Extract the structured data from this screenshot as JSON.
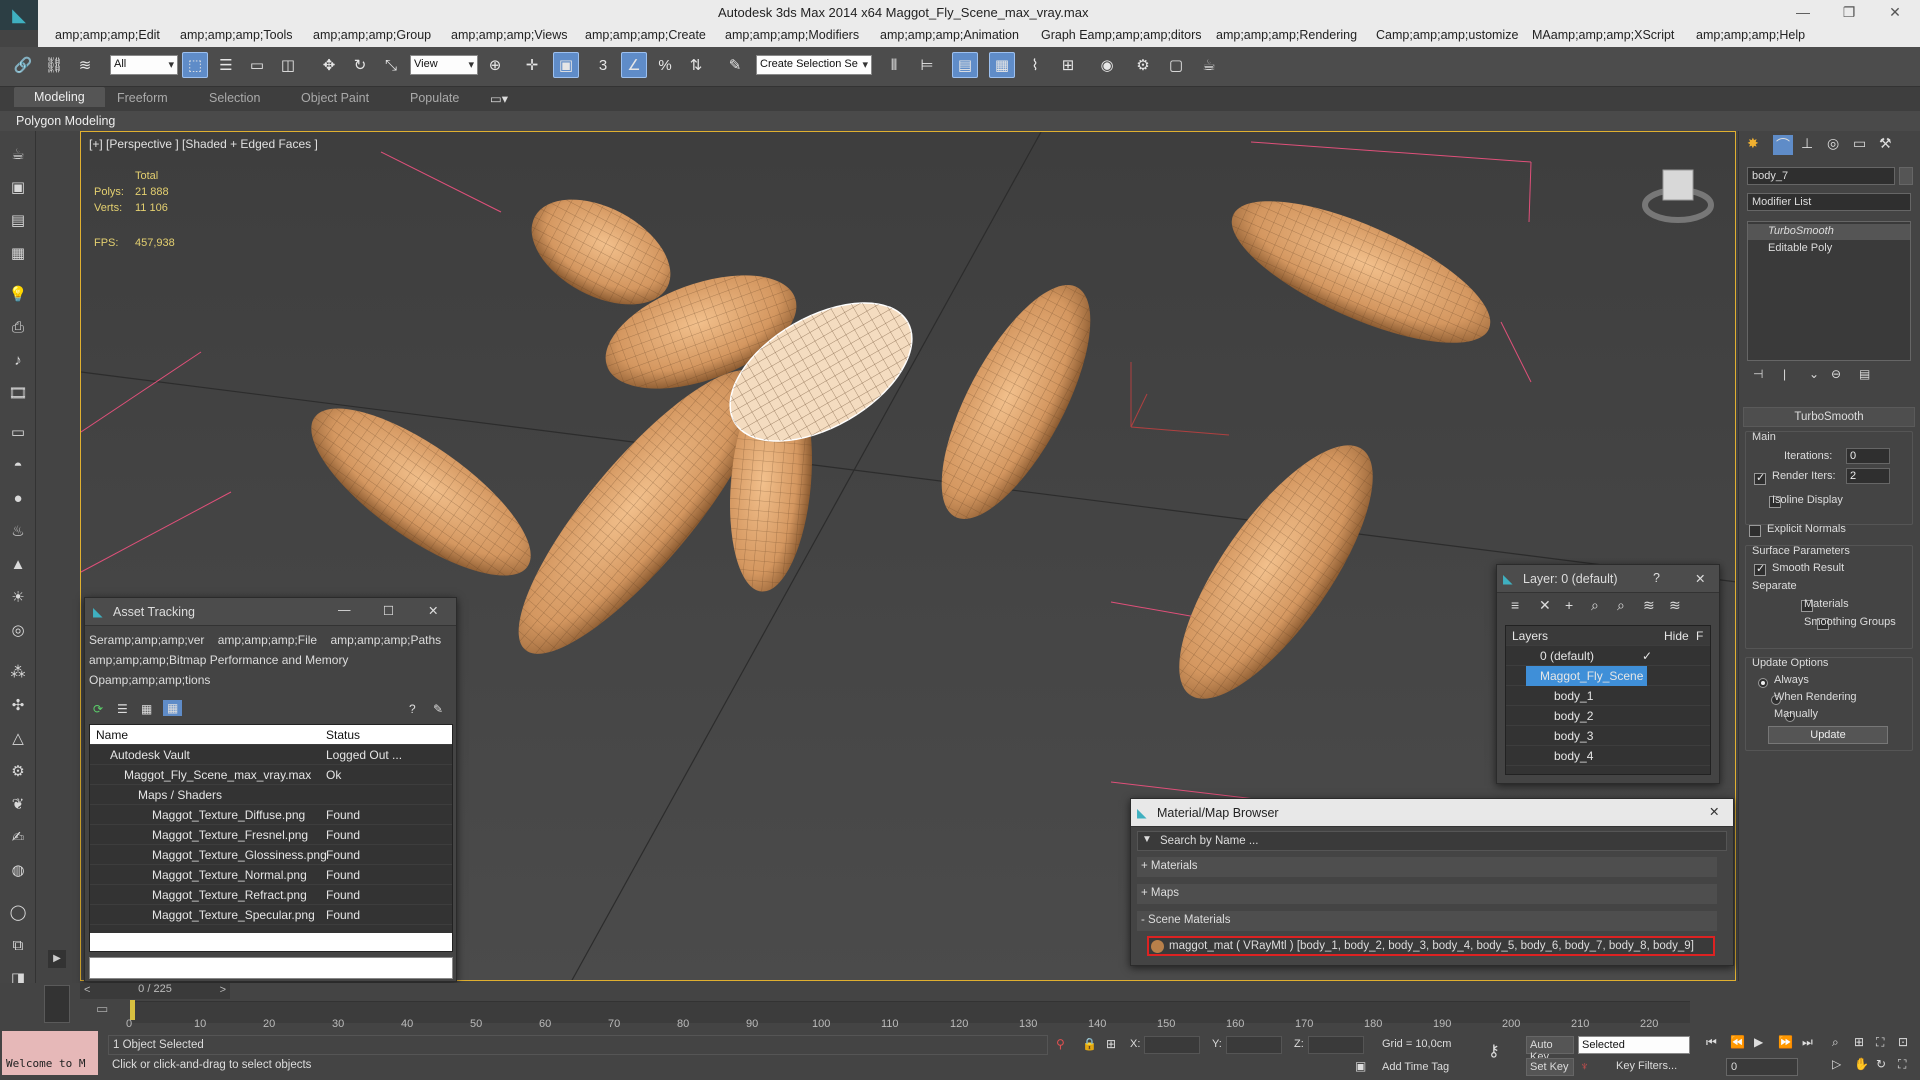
{
  "app": {
    "title": "Autodesk 3ds Max  2014 x64     Maggot_Fly_Scene_max_vray.max",
    "logo_icon": "3dsmax-logo-icon"
  },
  "menu": [
    "amp;amp;amp;Edit",
    "amp;amp;amp;Tools",
    "amp;amp;amp;Group",
    "amp;amp;amp;Views",
    "amp;amp;amp;Create",
    "amp;amp;amp;Modifiers",
    "amp;amp;amp;Animation",
    "Graph Eamp;amp;amp;ditors",
    "amp;amp;amp;Rendering",
    "Camp;amp;amp;ustomize",
    "MAamp;amp;amp;XScript",
    "amp;amp;amp;Help"
  ],
  "toolbar": {
    "selection_filter": "All",
    "ref_coord": "View",
    "named_selection": "Create Selection Se"
  },
  "ribbon": {
    "tabs": [
      "Modeling",
      "Freeform",
      "Selection",
      "Object Paint",
      "Populate"
    ],
    "active": "Modeling",
    "sub": "Polygon Modeling"
  },
  "viewport": {
    "label": "[+] [Perspective ] [Shaded + Edged Faces ]",
    "stats_header": "Total",
    "polys_label": "Polys:",
    "polys": "21 888",
    "verts_label": "Verts:",
    "verts": "11 106",
    "fps_label": "FPS:",
    "fps": "457,938"
  },
  "asset_tracking": {
    "title": "Asset Tracking",
    "menu": [
      "Seramp;amp;amp;ver",
      "amp;amp;amp;File",
      "amp;amp;amp;Paths",
      "amp;amp;amp;Bitmap Performance and Memory",
      "Opamp;amp;amp;tions"
    ],
    "col_name": "Name",
    "col_status": "Status",
    "rows": [
      {
        "name": "Autodesk Vault",
        "status": "Logged Out ..."
      },
      {
        "name": "Maggot_Fly_Scene_max_vray.max",
        "status": "Ok"
      },
      {
        "name": "Maps / Shaders",
        "status": ""
      },
      {
        "name": "Maggot_Texture_Diffuse.png",
        "status": "Found"
      },
      {
        "name": "Maggot_Texture_Fresnel.png",
        "status": "Found"
      },
      {
        "name": "Maggot_Texture_Glossiness.png",
        "status": "Found"
      },
      {
        "name": "Maggot_Texture_Normal.png",
        "status": "Found"
      },
      {
        "name": "Maggot_Texture_Refract.png",
        "status": "Found"
      },
      {
        "name": "Maggot_Texture_Specular.png",
        "status": "Found"
      }
    ]
  },
  "layer_dialog": {
    "title": "Layer: 0 (default)",
    "help": "?",
    "col_layers": "Layers",
    "col_hide": "Hide",
    "col_f": "F",
    "rows": [
      "0 (default)",
      "Maggot_Fly_Scene",
      "body_1",
      "body_2",
      "body_3",
      "body_4"
    ]
  },
  "material_browser": {
    "title": "Material/Map Browser",
    "search_placeholder": "Search by Name ...",
    "sections": [
      "+ Materials",
      "+ Maps",
      "- Scene Materials"
    ],
    "scene_material": "maggot_mat ( VRayMtl ) [body_1, body_2, body_3, body_4, body_5, body_6, body_7, body_8, body_9]"
  },
  "command_panel": {
    "object_name": "body_7",
    "modifier_list": "Modifier List",
    "stack": [
      "TurboSmooth",
      "Editable Poly"
    ],
    "rollout_title": "TurboSmooth",
    "main": "Main",
    "iterations_label": "Iterations:",
    "iterations": "0",
    "render_iters_label": "Render Iters:",
    "render_iters": "2",
    "isoline": "Isoline Display",
    "explicit": "Explicit Normals",
    "surface_params": "Surface Parameters",
    "smooth_result": "Smooth Result",
    "separate": "Separate",
    "materials": "Materials",
    "smoothing_groups": "Smoothing Groups",
    "update_options": "Update Options",
    "always": "Always",
    "when_rendering": "When Rendering",
    "manually": "Manually",
    "update": "Update"
  },
  "timeline": {
    "frame": "0 / 225",
    "ticks": [
      "0",
      "10",
      "20",
      "30",
      "40",
      "50",
      "60",
      "70",
      "80",
      "90",
      "100",
      "110",
      "120",
      "130",
      "140",
      "150",
      "160",
      "170",
      "180",
      "190",
      "200",
      "210",
      "220"
    ]
  },
  "status": {
    "maxscript": "Welcome to M",
    "selected": "1 Object Selected",
    "prompt": "Click or click-and-drag to select objects",
    "x_label": "X:",
    "y_label": "Y:",
    "z_label": "Z:",
    "grid": "Grid = 10,0cm",
    "add_time_tag": "Add Time Tag",
    "auto_key": "Auto Key",
    "selected_dd": "Selected",
    "set_key": "Set Key",
    "key_filters": "Key Filters...",
    "frame_field": "0"
  },
  "colors": {
    "accent": "#3f8fd8",
    "viewport_border": "#e0b030",
    "maggot": "#e2a468"
  }
}
